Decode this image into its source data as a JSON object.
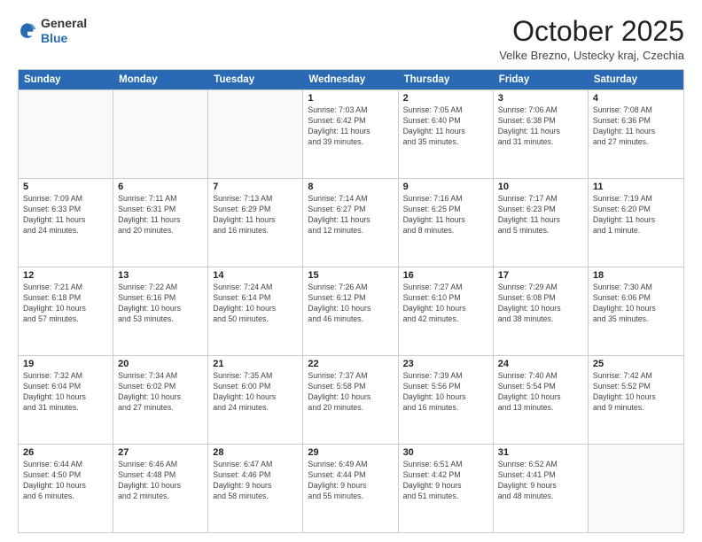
{
  "header": {
    "logo": {
      "line1": "General",
      "line2": "Blue"
    },
    "title": "October 2025",
    "location": "Velke Brezno, Ustecky kraj, Czechia"
  },
  "calendar": {
    "weekdays": [
      "Sunday",
      "Monday",
      "Tuesday",
      "Wednesday",
      "Thursday",
      "Friday",
      "Saturday"
    ],
    "rows": [
      [
        {
          "day": "",
          "info": "",
          "empty": true
        },
        {
          "day": "",
          "info": "",
          "empty": true
        },
        {
          "day": "",
          "info": "",
          "empty": true
        },
        {
          "day": "1",
          "info": "Sunrise: 7:03 AM\nSunset: 6:42 PM\nDaylight: 11 hours\nand 39 minutes."
        },
        {
          "day": "2",
          "info": "Sunrise: 7:05 AM\nSunset: 6:40 PM\nDaylight: 11 hours\nand 35 minutes."
        },
        {
          "day": "3",
          "info": "Sunrise: 7:06 AM\nSunset: 6:38 PM\nDaylight: 11 hours\nand 31 minutes."
        },
        {
          "day": "4",
          "info": "Sunrise: 7:08 AM\nSunset: 6:36 PM\nDaylight: 11 hours\nand 27 minutes."
        }
      ],
      [
        {
          "day": "5",
          "info": "Sunrise: 7:09 AM\nSunset: 6:33 PM\nDaylight: 11 hours\nand 24 minutes."
        },
        {
          "day": "6",
          "info": "Sunrise: 7:11 AM\nSunset: 6:31 PM\nDaylight: 11 hours\nand 20 minutes."
        },
        {
          "day": "7",
          "info": "Sunrise: 7:13 AM\nSunset: 6:29 PM\nDaylight: 11 hours\nand 16 minutes."
        },
        {
          "day": "8",
          "info": "Sunrise: 7:14 AM\nSunset: 6:27 PM\nDaylight: 11 hours\nand 12 minutes."
        },
        {
          "day": "9",
          "info": "Sunrise: 7:16 AM\nSunset: 6:25 PM\nDaylight: 11 hours\nand 8 minutes."
        },
        {
          "day": "10",
          "info": "Sunrise: 7:17 AM\nSunset: 6:23 PM\nDaylight: 11 hours\nand 5 minutes."
        },
        {
          "day": "11",
          "info": "Sunrise: 7:19 AM\nSunset: 6:20 PM\nDaylight: 11 hours\nand 1 minute."
        }
      ],
      [
        {
          "day": "12",
          "info": "Sunrise: 7:21 AM\nSunset: 6:18 PM\nDaylight: 10 hours\nand 57 minutes."
        },
        {
          "day": "13",
          "info": "Sunrise: 7:22 AM\nSunset: 6:16 PM\nDaylight: 10 hours\nand 53 minutes."
        },
        {
          "day": "14",
          "info": "Sunrise: 7:24 AM\nSunset: 6:14 PM\nDaylight: 10 hours\nand 50 minutes."
        },
        {
          "day": "15",
          "info": "Sunrise: 7:26 AM\nSunset: 6:12 PM\nDaylight: 10 hours\nand 46 minutes."
        },
        {
          "day": "16",
          "info": "Sunrise: 7:27 AM\nSunset: 6:10 PM\nDaylight: 10 hours\nand 42 minutes."
        },
        {
          "day": "17",
          "info": "Sunrise: 7:29 AM\nSunset: 6:08 PM\nDaylight: 10 hours\nand 38 minutes."
        },
        {
          "day": "18",
          "info": "Sunrise: 7:30 AM\nSunset: 6:06 PM\nDaylight: 10 hours\nand 35 minutes."
        }
      ],
      [
        {
          "day": "19",
          "info": "Sunrise: 7:32 AM\nSunset: 6:04 PM\nDaylight: 10 hours\nand 31 minutes."
        },
        {
          "day": "20",
          "info": "Sunrise: 7:34 AM\nSunset: 6:02 PM\nDaylight: 10 hours\nand 27 minutes."
        },
        {
          "day": "21",
          "info": "Sunrise: 7:35 AM\nSunset: 6:00 PM\nDaylight: 10 hours\nand 24 minutes."
        },
        {
          "day": "22",
          "info": "Sunrise: 7:37 AM\nSunset: 5:58 PM\nDaylight: 10 hours\nand 20 minutes."
        },
        {
          "day": "23",
          "info": "Sunrise: 7:39 AM\nSunset: 5:56 PM\nDaylight: 10 hours\nand 16 minutes."
        },
        {
          "day": "24",
          "info": "Sunrise: 7:40 AM\nSunset: 5:54 PM\nDaylight: 10 hours\nand 13 minutes."
        },
        {
          "day": "25",
          "info": "Sunrise: 7:42 AM\nSunset: 5:52 PM\nDaylight: 10 hours\nand 9 minutes."
        }
      ],
      [
        {
          "day": "26",
          "info": "Sunrise: 6:44 AM\nSunset: 4:50 PM\nDaylight: 10 hours\nand 6 minutes."
        },
        {
          "day": "27",
          "info": "Sunrise: 6:46 AM\nSunset: 4:48 PM\nDaylight: 10 hours\nand 2 minutes."
        },
        {
          "day": "28",
          "info": "Sunrise: 6:47 AM\nSunset: 4:46 PM\nDaylight: 9 hours\nand 58 minutes."
        },
        {
          "day": "29",
          "info": "Sunrise: 6:49 AM\nSunset: 4:44 PM\nDaylight: 9 hours\nand 55 minutes."
        },
        {
          "day": "30",
          "info": "Sunrise: 6:51 AM\nSunset: 4:42 PM\nDaylight: 9 hours\nand 51 minutes."
        },
        {
          "day": "31",
          "info": "Sunrise: 6:52 AM\nSunset: 4:41 PM\nDaylight: 9 hours\nand 48 minutes."
        },
        {
          "day": "",
          "info": "",
          "empty": true
        }
      ]
    ]
  }
}
